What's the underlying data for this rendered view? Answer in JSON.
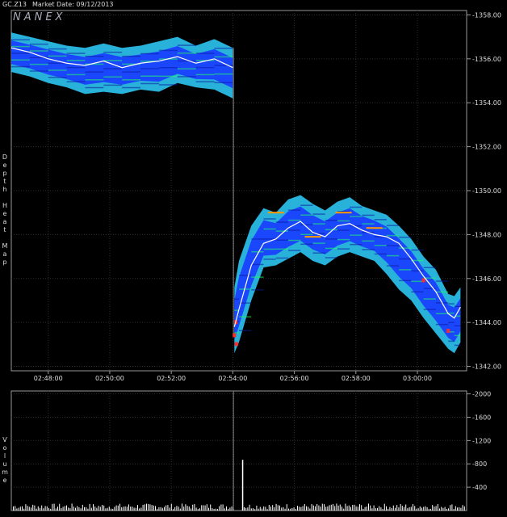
{
  "header": {
    "symbol": "GC.Z13",
    "market_date": "Market Date: 09/12/2013"
  },
  "watermark": "NANEX",
  "panels": {
    "heatmap_label": "Depth Heat Map",
    "volume_label": "Volume"
  },
  "colors": {
    "background": "#000000",
    "grid": "#2f2f2f",
    "axis": "#9a9a9a",
    "price_line": "#ffffff",
    "heat_low": "#1a3cff",
    "heat_mid": "#2fd0ff",
    "heat_high": "#19ff60",
    "heat_hot": "#ff2a2a"
  },
  "chart_data": [
    {
      "type": "heatmap",
      "title": "",
      "ylabel": "Depth Heat Map",
      "x_tick_labels": [
        "02:48:00",
        "02:50:00",
        "02:52:00",
        "02:54:00",
        "02:56:00",
        "02:58:00",
        "03:00:00"
      ],
      "y_tick_labels": [
        "1358.00",
        "1356.00",
        "1354.00",
        "1352.00",
        "1350.00",
        "1348.00",
        "1346.00",
        "1344.00",
        "1342.00"
      ],
      "ylim": [
        1341.8,
        1358.2
      ],
      "xlim_minutes": [
        -1.2,
        13.6
      ],
      "grid": true,
      "price_series": {
        "x_minutes": [
          -1.2,
          -0.6,
          0,
          0.6,
          1.2,
          1.8,
          2.4,
          3,
          3.6,
          4.2,
          4.8,
          5.4,
          6,
          6.05,
          6.2,
          6.6,
          7,
          7.4,
          7.8,
          8.2,
          8.6,
          9,
          9.4,
          9.8,
          10.2,
          10.6,
          11,
          11.4,
          11.8,
          12.2,
          12.6,
          13,
          13.2,
          13.4
        ],
        "price": [
          1356.5,
          1356.3,
          1356.0,
          1355.8,
          1355.7,
          1355.9,
          1355.6,
          1355.8,
          1355.9,
          1356.1,
          1355.8,
          1356.0,
          1355.6,
          1343.8,
          1344.6,
          1346.6,
          1347.6,
          1347.8,
          1348.3,
          1348.6,
          1348.1,
          1347.9,
          1348.4,
          1348.5,
          1348.2,
          1348.0,
          1347.9,
          1347.6,
          1346.9,
          1346.1,
          1345.4,
          1344.4,
          1344.2,
          1344.7
        ]
      },
      "depth_band": {
        "x_minutes": [
          -1.2,
          -0.6,
          0,
          0.6,
          1.2,
          1.8,
          2.4,
          3,
          3.6,
          4.2,
          4.8,
          5.4,
          6,
          6.05,
          6.2,
          6.6,
          7,
          7.4,
          7.8,
          8.2,
          8.6,
          9,
          9.4,
          9.8,
          10.2,
          10.6,
          11,
          11.4,
          11.8,
          12.2,
          12.6,
          13,
          13.2,
          13.4
        ],
        "high": [
          1357.2,
          1357.0,
          1356.8,
          1356.6,
          1356.5,
          1356.7,
          1356.5,
          1356.6,
          1356.8,
          1357.0,
          1356.6,
          1356.9,
          1356.5,
          1345.6,
          1346.8,
          1348.4,
          1349.2,
          1349.0,
          1349.6,
          1349.8,
          1349.4,
          1349.1,
          1349.5,
          1349.7,
          1349.3,
          1349.1,
          1348.9,
          1348.4,
          1347.8,
          1347.0,
          1346.4,
          1345.3,
          1345.2,
          1345.6
        ],
        "low": [
          1355.4,
          1355.2,
          1354.9,
          1354.7,
          1354.4,
          1354.5,
          1354.4,
          1354.6,
          1354.5,
          1354.9,
          1354.7,
          1354.6,
          1354.2,
          1342.6,
          1343.1,
          1345.0,
          1346.5,
          1346.6,
          1346.9,
          1347.2,
          1346.8,
          1346.6,
          1347.0,
          1347.2,
          1347.0,
          1346.8,
          1346.2,
          1345.5,
          1345.0,
          1344.2,
          1343.5,
          1342.8,
          1342.6,
          1343.1
        ]
      }
    },
    {
      "type": "bar",
      "title": "",
      "ylabel": "Volume",
      "y_tick_labels": [
        "2000",
        "1600",
        "1200",
        "800",
        "400"
      ],
      "ylim": [
        0,
        2050
      ],
      "grid": true,
      "spike": {
        "x_minutes": 6.3,
        "value": 870
      },
      "baseline_volume": 120
    }
  ]
}
